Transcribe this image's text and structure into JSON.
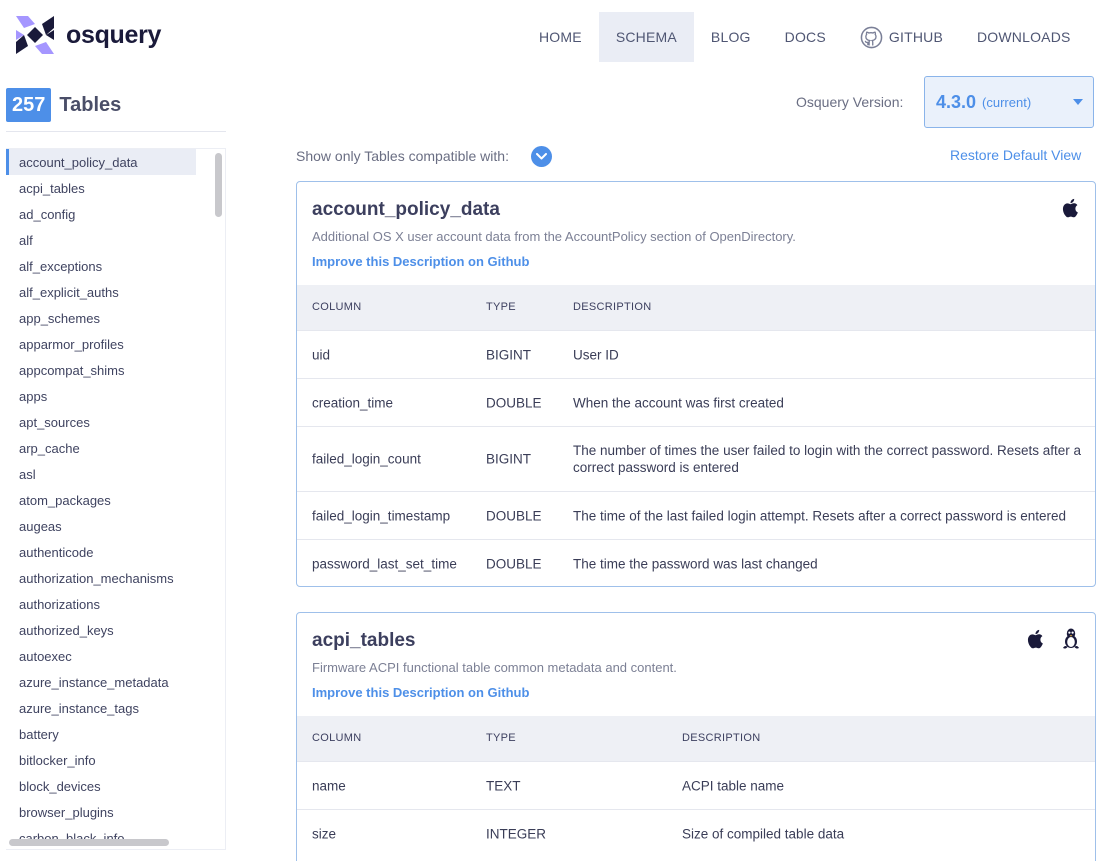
{
  "brand": {
    "name": "osquery"
  },
  "nav": [
    {
      "label": "HOME",
      "active": false
    },
    {
      "label": "SCHEMA",
      "active": true
    },
    {
      "label": "BLOG",
      "active": false
    },
    {
      "label": "DOCS",
      "active": false
    },
    {
      "label": "GITHUB",
      "active": false
    },
    {
      "label": "DOWNLOADS",
      "active": false
    }
  ],
  "sidebar": {
    "count": "257",
    "count_label": "Tables",
    "items": [
      "account_policy_data",
      "acpi_tables",
      "ad_config",
      "alf",
      "alf_exceptions",
      "alf_explicit_auths",
      "app_schemes",
      "apparmor_profiles",
      "appcompat_shims",
      "apps",
      "apt_sources",
      "arp_cache",
      "asl",
      "atom_packages",
      "augeas",
      "authenticode",
      "authorization_mechanisms",
      "authorizations",
      "authorized_keys",
      "autoexec",
      "azure_instance_metadata",
      "azure_instance_tags",
      "battery",
      "bitlocker_info",
      "block_devices",
      "browser_plugins",
      "carbon_black_info"
    ]
  },
  "version": {
    "label": "Osquery Version:",
    "number": "4.3.0",
    "current": "(current)"
  },
  "filter": {
    "label": "Show only Tables compatible with:",
    "restore": "Restore Default View"
  },
  "colors": {
    "accent": "#4d8fe8",
    "nav_active_bg": "#eaedf5",
    "card_border": "#9fc0ea"
  },
  "tables": [
    {
      "name": "account_policy_data",
      "description": "Additional OS X user account data from the AccountPolicy section of OpenDirectory.",
      "link": "Improve this Description on Github",
      "platforms": [
        "apple-icon"
      ],
      "headers": [
        "COLUMN",
        "TYPE",
        "DESCRIPTION"
      ],
      "rows": [
        [
          "uid",
          "BIGINT",
          "User ID"
        ],
        [
          "creation_time",
          "DOUBLE",
          "When the account was first created"
        ],
        [
          "failed_login_count",
          "BIGINT",
          "The number of times the user failed to login with the correct password. Resets after a correct password is entered"
        ],
        [
          "failed_login_timestamp",
          "DOUBLE",
          "The time of the last failed login attempt. Resets after a correct password is entered"
        ],
        [
          "password_last_set_time",
          "DOUBLE",
          "The time the password was last changed"
        ]
      ]
    },
    {
      "name": "acpi_tables",
      "description": "Firmware ACPI functional table common metadata and content.",
      "link": "Improve this Description on Github",
      "platforms": [
        "apple-icon",
        "linux-icon"
      ],
      "headers": [
        "COLUMN",
        "TYPE",
        "DESCRIPTION"
      ],
      "rows": [
        [
          "name",
          "TEXT",
          "ACPI table name"
        ],
        [
          "size",
          "INTEGER",
          "Size of compiled table data"
        ]
      ]
    }
  ]
}
